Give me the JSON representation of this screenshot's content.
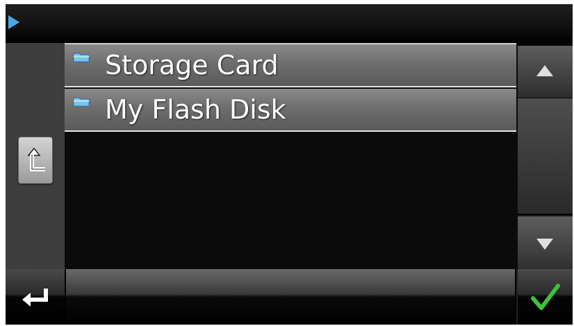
{
  "header": {
    "icon": "play-icon",
    "icon_color": "#4aa8e6"
  },
  "file_list": {
    "items": [
      {
        "label": "Storage Card",
        "icon": "folder-icon"
      },
      {
        "label": "My Flash Disk",
        "icon": "folder-icon"
      }
    ]
  },
  "navigation": {
    "up_folder_icon": "up-folder-icon",
    "scroll_up_icon": "arrow-up-icon",
    "scroll_down_icon": "arrow-down-icon"
  },
  "footer": {
    "back_icon": "return-arrow-icon",
    "ok_icon": "checkmark-icon",
    "ok_color": "#3cc23c"
  }
}
